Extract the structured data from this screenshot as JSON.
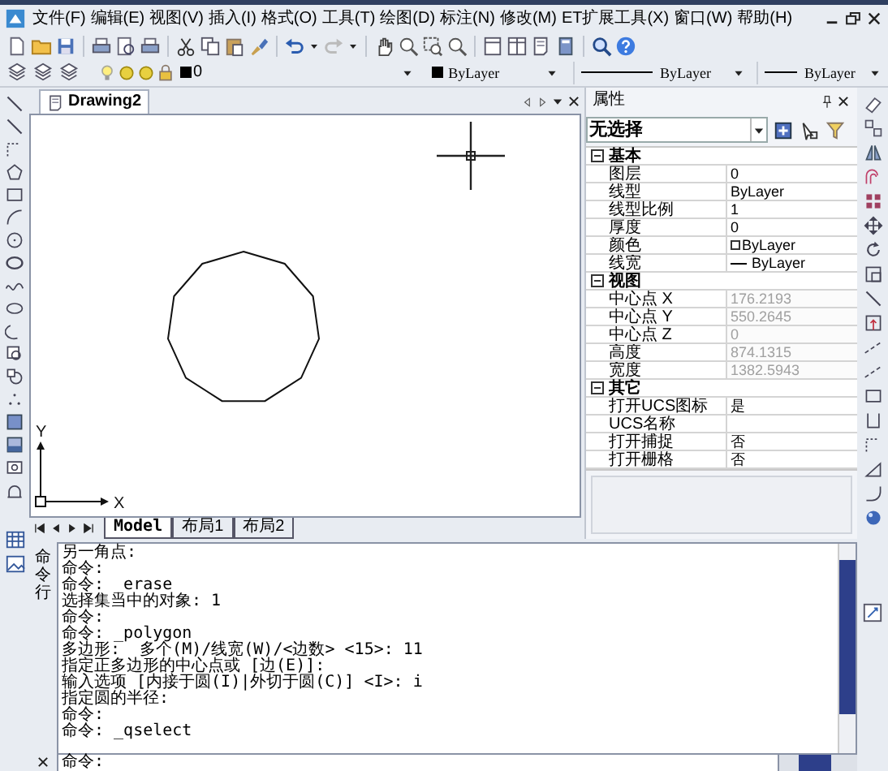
{
  "menu_bar": {
    "items": [
      "文件(F)",
      "编辑(E)",
      "视图(V)",
      "插入(I)",
      "格式(O)",
      "工具(T)",
      "绘图(D)",
      "标注(N)",
      "修改(M)",
      "ET扩展工具(X)",
      "窗口(W)",
      "帮助(H)"
    ]
  },
  "properties_toolbar": {
    "layer": "0",
    "color_setting": "ByLayer",
    "linetype": "ByLayer",
    "lineweight": "ByLayer"
  },
  "document_tab": {
    "title": "Drawing2"
  },
  "drawing": {
    "ucs_x_label": "X",
    "ucs_y_label": "Y"
  },
  "layout_tabs": [
    {
      "label": "Model",
      "selected": true
    },
    {
      "label": "布局1",
      "selected": false
    },
    {
      "label": "布局2",
      "selected": false
    }
  ],
  "properties": {
    "title": "属性",
    "selection": "无选择",
    "sections": [
      {
        "name": "基本",
        "expanded": true,
        "rows": [
          {
            "label": "图层",
            "value": "0",
            "kind": "text",
            "readonly": false
          },
          {
            "label": "线型",
            "value": "ByLayer",
            "kind": "text",
            "readonly": false
          },
          {
            "label": "线型比例",
            "value": "1",
            "kind": "text",
            "readonly": false
          },
          {
            "label": "厚度",
            "value": "0",
            "kind": "text",
            "readonly": false
          },
          {
            "label": "颜色",
            "value": "ByLayer",
            "kind": "color",
            "readonly": false
          },
          {
            "label": "线宽",
            "value": "ByLayer",
            "kind": "lineweight",
            "readonly": false
          }
        ]
      },
      {
        "name": "视图",
        "expanded": true,
        "rows": [
          {
            "label": "中心点 X",
            "value": "176.2193",
            "kind": "text",
            "readonly": true
          },
          {
            "label": "中心点 Y",
            "value": "550.2645",
            "kind": "text",
            "readonly": true
          },
          {
            "label": "中心点 Z",
            "value": "0",
            "kind": "text",
            "readonly": true
          },
          {
            "label": "高度",
            "value": "874.1315",
            "kind": "text",
            "readonly": true
          },
          {
            "label": "宽度",
            "value": "1382.5943",
            "kind": "text",
            "readonly": true
          }
        ]
      },
      {
        "name": "其它",
        "expanded": true,
        "rows": [
          {
            "label": "打开UCS图标",
            "value": "是",
            "kind": "text",
            "readonly": false
          },
          {
            "label": "UCS名称",
            "kind": "text",
            "readonly": false
          },
          {
            "label": "打开捕捉",
            "value": "否",
            "kind": "text",
            "readonly": false
          },
          {
            "label": "打开栅格",
            "value": "否",
            "kind": "text",
            "readonly": false
          }
        ]
      }
    ]
  },
  "command_window": {
    "title": "命令行",
    "lines": [
      "另一角点:",
      "命令:",
      "命令: _erase",
      "选择集当中的对象: 1",
      "命令:",
      "命令: _polygon",
      "多边形:  多个(M)/线宽(W)/<边数> <15>: 11",
      "指定正多边形的中心点或 [边(E)]:",
      "输入选项 [内接于圆(I)|外切于圆(C)] <I>: i",
      "指定圆的半径:",
      "命令:",
      "命令: _qselect"
    ],
    "prompt": "命令:"
  }
}
